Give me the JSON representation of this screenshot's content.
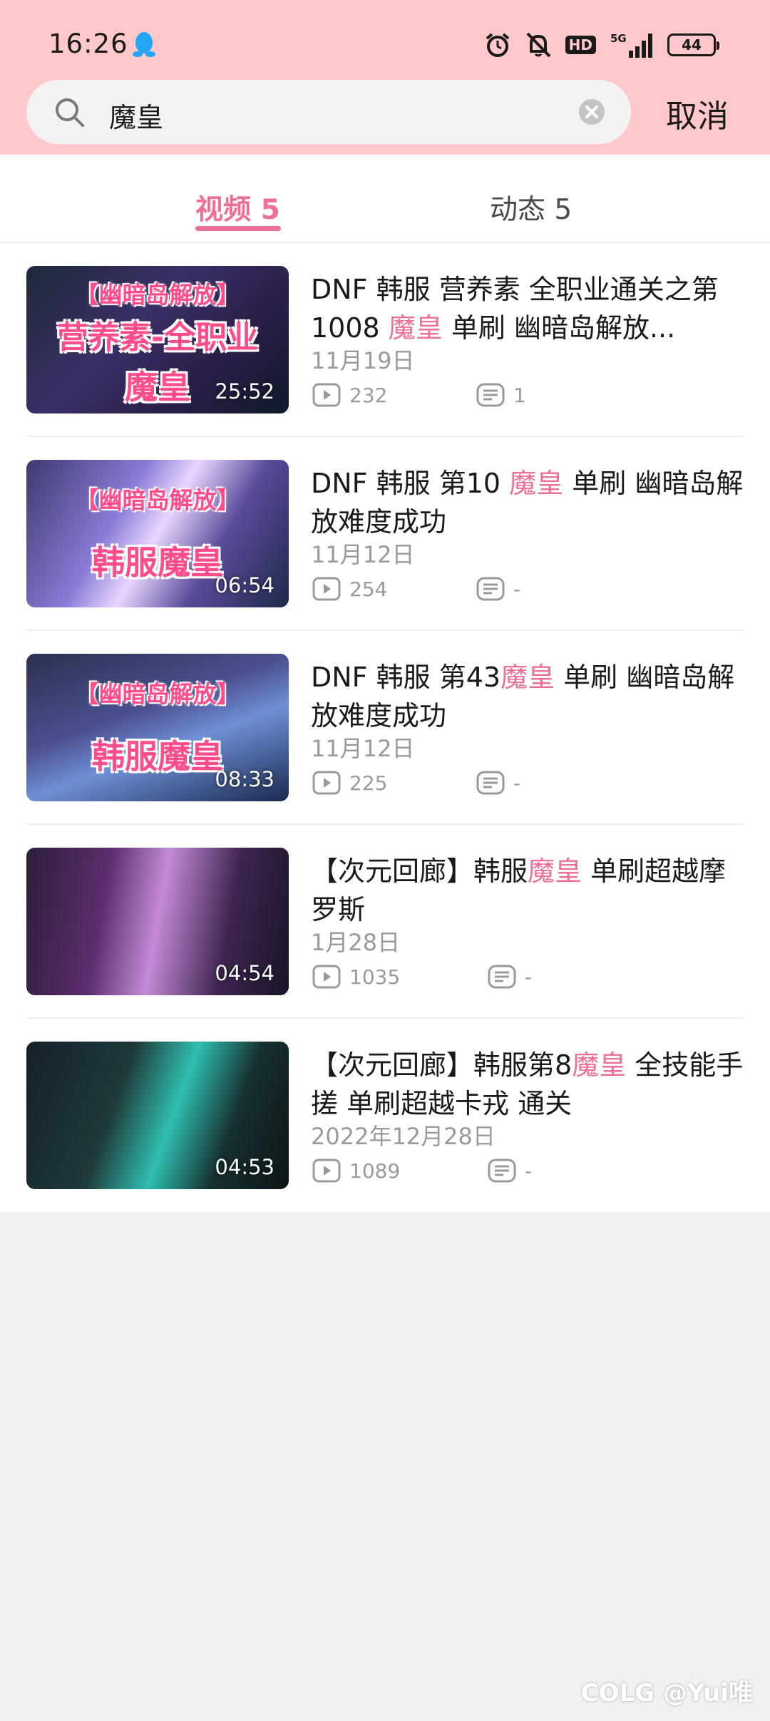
{
  "status_bar": {
    "time": "16:26",
    "hd": "HD",
    "network": "5G",
    "battery": "44"
  },
  "search": {
    "query": "魔皇",
    "cancel_label": "取消",
    "icons": [
      "search-icon",
      "clear-icon"
    ]
  },
  "tabs": [
    {
      "label": "视频 5",
      "active": true
    },
    {
      "label": "动态 5",
      "active": false
    }
  ],
  "colors": {
    "header_bg": "#ffc9cc",
    "accent": "#ef7097",
    "page_bg": "#f1f1f3"
  },
  "videos": [
    {
      "title_parts": [
        "DNF 韩服 营养素 全职业通关之第1008 ",
        "魔皇",
        " 单刷 幽暗岛解放..."
      ],
      "date": "11月19日",
      "plays": "232",
      "comments": "1",
      "duration": "25:52",
      "thumb_top": "【幽暗岛解放】",
      "thumb_mid": "营养素-全职业",
      "thumb_bottom": "魔皇"
    },
    {
      "title_parts": [
        "DNF 韩服 第10 ",
        "魔皇",
        " 单刷 幽暗岛解放难度成功"
      ],
      "date": "11月12日",
      "plays": "254",
      "comments": "-",
      "duration": "06:54",
      "thumb_top": "【幽暗岛解放】",
      "thumb_mid": "",
      "thumb_bottom": "韩服魔皇"
    },
    {
      "title_parts": [
        "DNF 韩服 第43",
        "魔皇",
        " 单刷 幽暗岛解放难度成功"
      ],
      "date": "11月12日",
      "plays": "225",
      "comments": "-",
      "duration": "08:33",
      "thumb_top": "【幽暗岛解放】",
      "thumb_mid": "",
      "thumb_bottom": "韩服魔皇"
    },
    {
      "title_parts": [
        "【次元回廊】韩服",
        "魔皇",
        " 单刷超越摩罗斯"
      ],
      "date": "1月28日",
      "plays": "1035",
      "comments": "-",
      "duration": "04:54",
      "thumb_top": "",
      "thumb_mid": "",
      "thumb_bottom": ""
    },
    {
      "title_parts": [
        "【次元回廊】韩服第8",
        "魔皇",
        " 全技能手搓 单刷超越卡戎 通关"
      ],
      "date": "2022年12月28日",
      "plays": "1089",
      "comments": "-",
      "duration": "04:53",
      "thumb_top": "",
      "thumb_mid": "",
      "thumb_bottom": ""
    }
  ],
  "watermark": "COLG @Yui唯"
}
